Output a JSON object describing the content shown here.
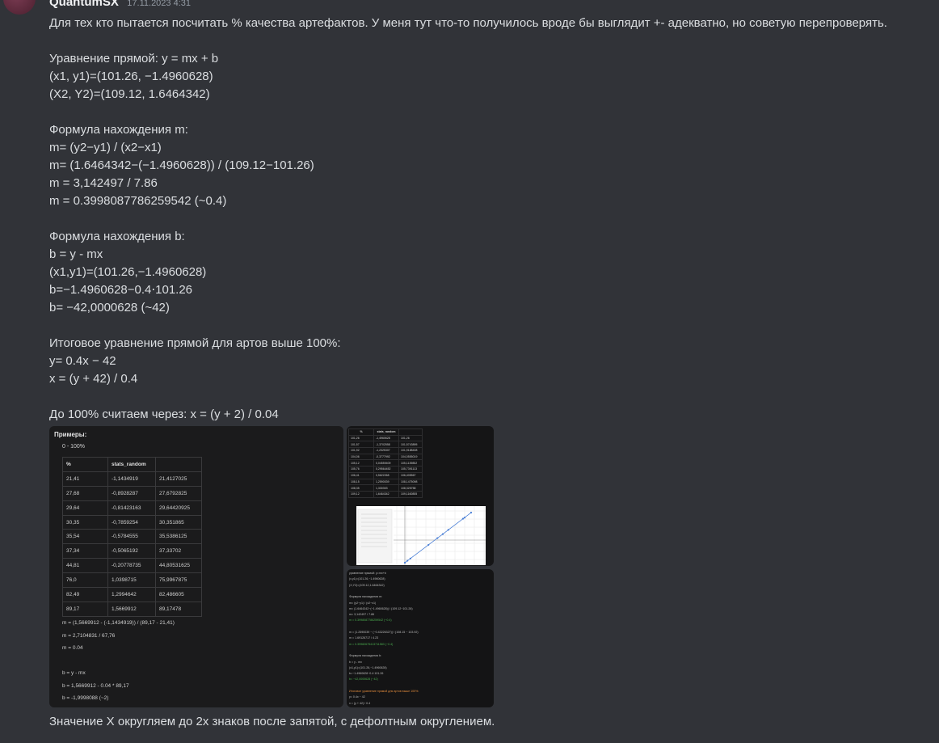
{
  "author": {
    "name": "QuantumSX",
    "timestamp": "17.11.2023 4:31"
  },
  "message": {
    "lines": [
      "Для тех кто пытается посчитать % качества артефактов. У меня тут что-то получилось вроде бы выглядит +- адекватно, но советую перепроверять.",
      "",
      "Уравнение прямой: y = mx + b",
      "(x1, y1)=(101.26, −1.4960628)",
      "(X2, Y2)=(109.12, 1.6464342)",
      "",
      "Формула нахождения m:",
      "m= (y2−y1) / (x2−x1)",
      "m= (1.6464342−(−1.4960628)) / (109.12−101.26)",
      "m =  3,142497 / 7.86",
      "m = 0.3998087786259542 (~0.4)",
      "",
      "Формула нахождения b:",
      "b = y - mx",
      "(x1,y1)=(101.26,−1.4960628)",
      "b=−1.4960628−0.4⋅101.26",
      "b= −42,0000628 (~42)",
      "",
      "Итоговое уравнение прямой для артов выше 100%:",
      " y= 0.4x − 42",
      "x = (y + 42) / 0.4",
      "",
      "До 100% считаем через:  x = (y + 2) / 0.04"
    ],
    "footer": "Значение X округляем до 2х знаков после запятой, с дефолтным округлением."
  },
  "attachment1": {
    "title": "Примеры:",
    "subtitle": "0 - 100%",
    "headers": [
      "%",
      "stats_random",
      ""
    ],
    "rows": [
      [
        "21,41",
        "-1,1434919",
        "21,4127025"
      ],
      [
        "27,68",
        "-0,8928287",
        "27,6792825"
      ],
      [
        "29,64",
        "-0,81423163",
        "29,64420925"
      ],
      [
        "30,35",
        "-0,7859254",
        "30,351865"
      ],
      [
        "35,54",
        "-0,5784555",
        "35,5386125"
      ],
      [
        "37,34",
        "-0,5065192",
        "37,33702"
      ],
      [
        "44,81",
        "-0,20778735",
        "44,80531625"
      ],
      [
        "76,0",
        "1,0398715",
        "75,9967875"
      ],
      [
        "82,49",
        "1,2994642",
        "82,486605"
      ],
      [
        "89,17",
        "1,5669912",
        "89,17478"
      ]
    ],
    "formulas": [
      "m = (1,5669912 - (-1,1434919)) / (89,17 - 21,41)",
      "m = 2,7104831 / 67,76",
      "m = 0.04",
      "",
      "b = y - mx",
      "b = 1,5669912 - 0.04 * 89,17",
      "b = -1,9998088 (~2)"
    ]
  },
  "attachment2": {
    "headers": [
      "%",
      "stats_random",
      ""
    ],
    "rows": [
      [
        "101,26",
        "-1,4960628",
        "101,26"
      ],
      [
        "101,57",
        "-1,3702558",
        "101,5743895"
      ],
      [
        "101,92",
        "-1,2325307",
        "101,9188408"
      ],
      [
        "104,06",
        "-0,3777992",
        "104,0555019"
      ],
      [
        "105,12",
        "0,04559409",
        "105,1139852"
      ],
      [
        "105,76",
        "0,29564452",
        "105,7391113"
      ],
      [
        "106,41",
        "0,5622268",
        "106,405567"
      ],
      [
        "108,15",
        "1,2590039",
        "108,1475098"
      ],
      [
        "108,35",
        "1,330303",
        "108,325758"
      ],
      [
        "109,12",
        "1,6464342",
        "109,1160855"
      ]
    ]
  },
  "attachment3": {
    "lines": [
      "уравнение прямой: y=mx+b",
      "(x,y1)=(101.26,−1.4960628)",
      "(X,Y2)=(109.12,1.6464342)",
      "",
      "Формула нахождения m:",
      "m= (y2−y1) / (x2−x1)",
      "m= (1.6464342−(−1.4960628)) / (109.12−101.26)",
      "m= 3,142497 / 7.86",
      "m = 0.3998087786259542 (~0.4)",
      "",
      "m = (1.2590039 − (−0.43226327)) / (108.15 − 103.92)",
      "m = 1.69126717 / 4.23",
      "m = 0.39982675413711583 (~0.4)",
      "",
      "Формула нахождения b:",
      "b = y - mx",
      "(x1,y1)=(101.26,−1.4960628)",
      "b=−1.4960628−0.4⋅101.26",
      "b= −42,0000628 (~42)",
      "",
      "Итоговое уравнение прямой для артов выше 100%:",
      "y= 0.4x − 42",
      "x = (y + 42) / 0.4"
    ]
  },
  "colors": {
    "background": "#313338",
    "text": "#dbdee1",
    "muted": "#949ba4",
    "accent": "#4a7fd6"
  }
}
